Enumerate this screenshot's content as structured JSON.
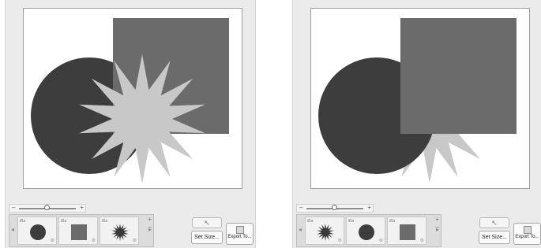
{
  "panels": [
    {
      "layers": [
        "circle",
        "square",
        "star"
      ],
      "canvas_order": [
        "circle",
        "square",
        "star"
      ]
    },
    {
      "layers": [
        "star",
        "circle",
        "square"
      ],
      "canvas_order": [
        "star",
        "circle",
        "square"
      ]
    }
  ],
  "thumb_tag": "iBa",
  "controls": {
    "set_size_label": "Set Size...",
    "export_label": "Export To...",
    "zoom_minus": "–",
    "zoom_plus": "+",
    "layer_add": "+",
    "layer_remove": "–",
    "arrow_left": "◂",
    "arrow_right": "▸",
    "pointer_glyph": "↖"
  },
  "colors": {
    "circle": "#3d3d3d",
    "square": "#6b6b6b",
    "star": "#c8c8c8"
  }
}
